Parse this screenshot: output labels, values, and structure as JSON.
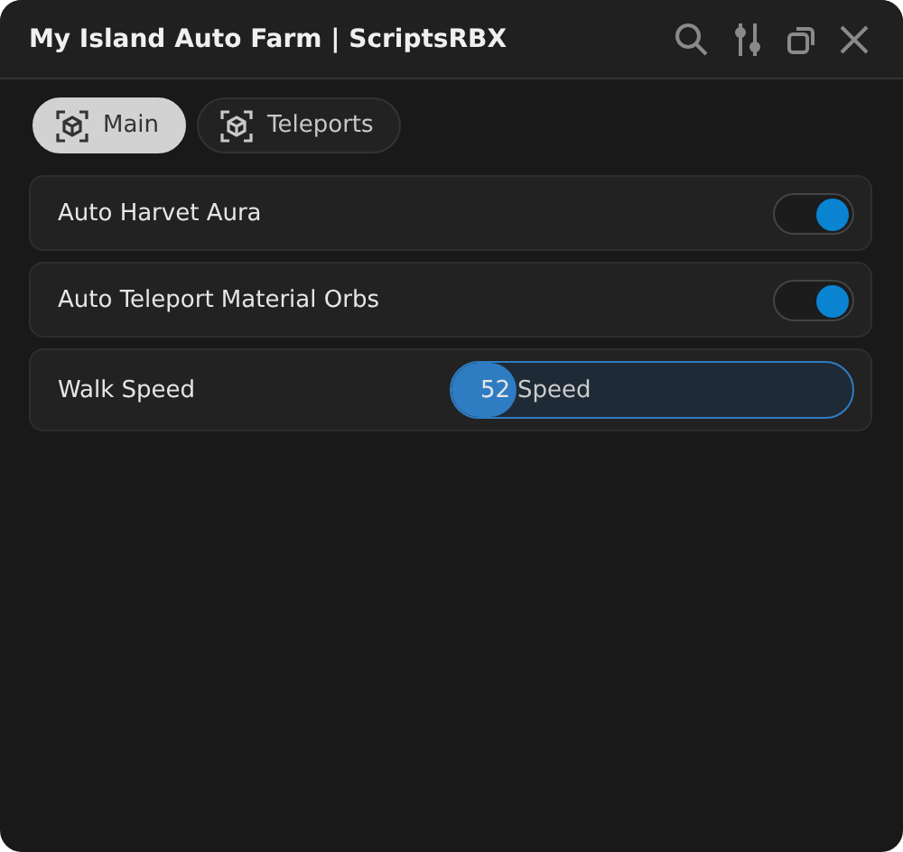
{
  "window": {
    "title": "My Island Auto Farm | ScriptsRBX"
  },
  "tabs": [
    {
      "label": "Main",
      "selected": true
    },
    {
      "label": "Teleports",
      "selected": false
    }
  ],
  "items": [
    {
      "kind": "toggle",
      "label": "Auto Harvet Aura",
      "on": true
    },
    {
      "kind": "toggle",
      "label": "Auto Teleport Material Orbs",
      "on": true
    },
    {
      "kind": "slider",
      "label": "Walk Speed",
      "value": "52",
      "unit": "Speed",
      "level": 0.16
    }
  ]
}
